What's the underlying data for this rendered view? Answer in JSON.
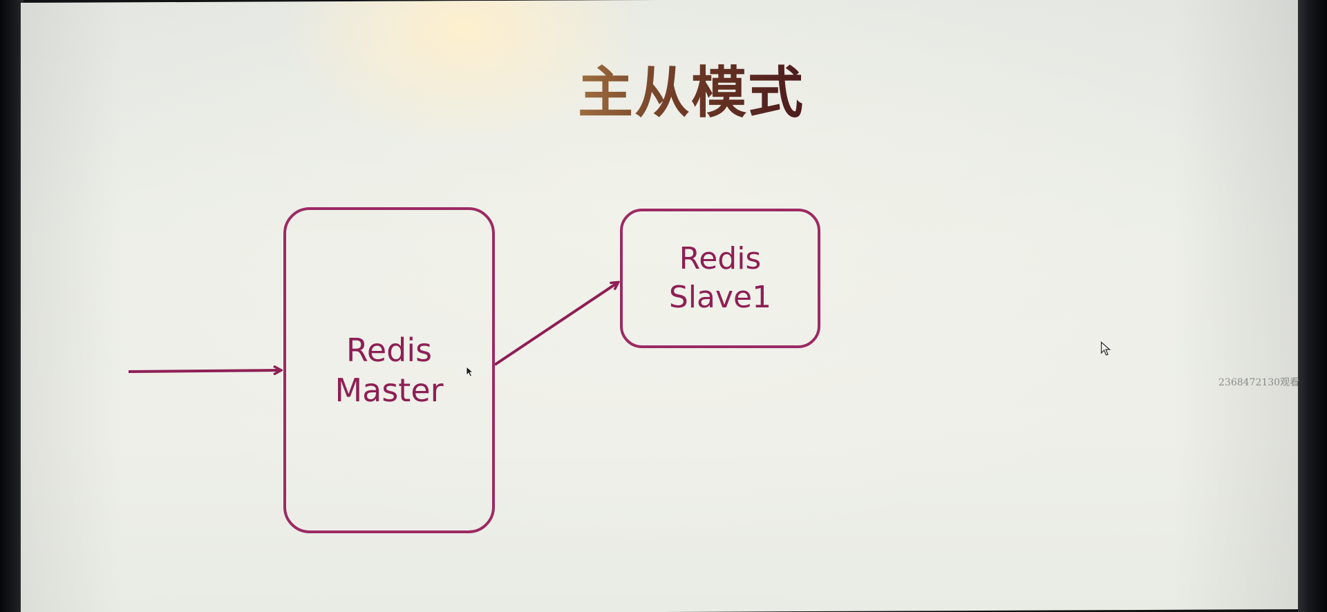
{
  "slide": {
    "title": "主从模式",
    "watermark": "2368472130观看"
  },
  "nodes": [
    {
      "id": "master",
      "label": "Redis\nMaster"
    },
    {
      "id": "slave1",
      "label": "Redis\nSlave1"
    }
  ],
  "edges": [
    {
      "from": "external-input",
      "to": "master"
    },
    {
      "from": "master",
      "to": "slave1"
    }
  ],
  "colors": {
    "node_border": "#9c2a63",
    "node_text": "#8e1f55",
    "arrow": "#8e1f55",
    "title_gradient_start": "#a0703f",
    "title_gradient_end": "#4a1a1c"
  },
  "icons": {
    "cursor": "mouse-pointer-icon"
  }
}
